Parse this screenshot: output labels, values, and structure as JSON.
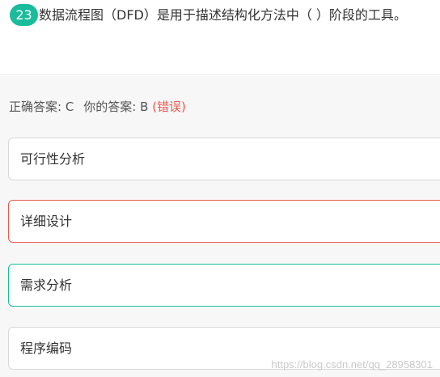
{
  "question": {
    "number": "23",
    "text": "数据流程图（DFD）是用于描述结构化方法中（ ）阶段的工具。"
  },
  "answer": {
    "correct_label": "正确答案: C",
    "your_label": "你的答案: B",
    "status": "(错误)"
  },
  "options": [
    {
      "label": "可行性分析",
      "state": "normal"
    },
    {
      "label": "详细设计",
      "state": "wrong"
    },
    {
      "label": "需求分析",
      "state": "correct"
    },
    {
      "label": "程序编码",
      "state": "normal"
    }
  ],
  "watermark": "https://blog.csdn.net/qq_28958301",
  "colors": {
    "accent": "#1bbc9b",
    "error": "#e9584d"
  }
}
